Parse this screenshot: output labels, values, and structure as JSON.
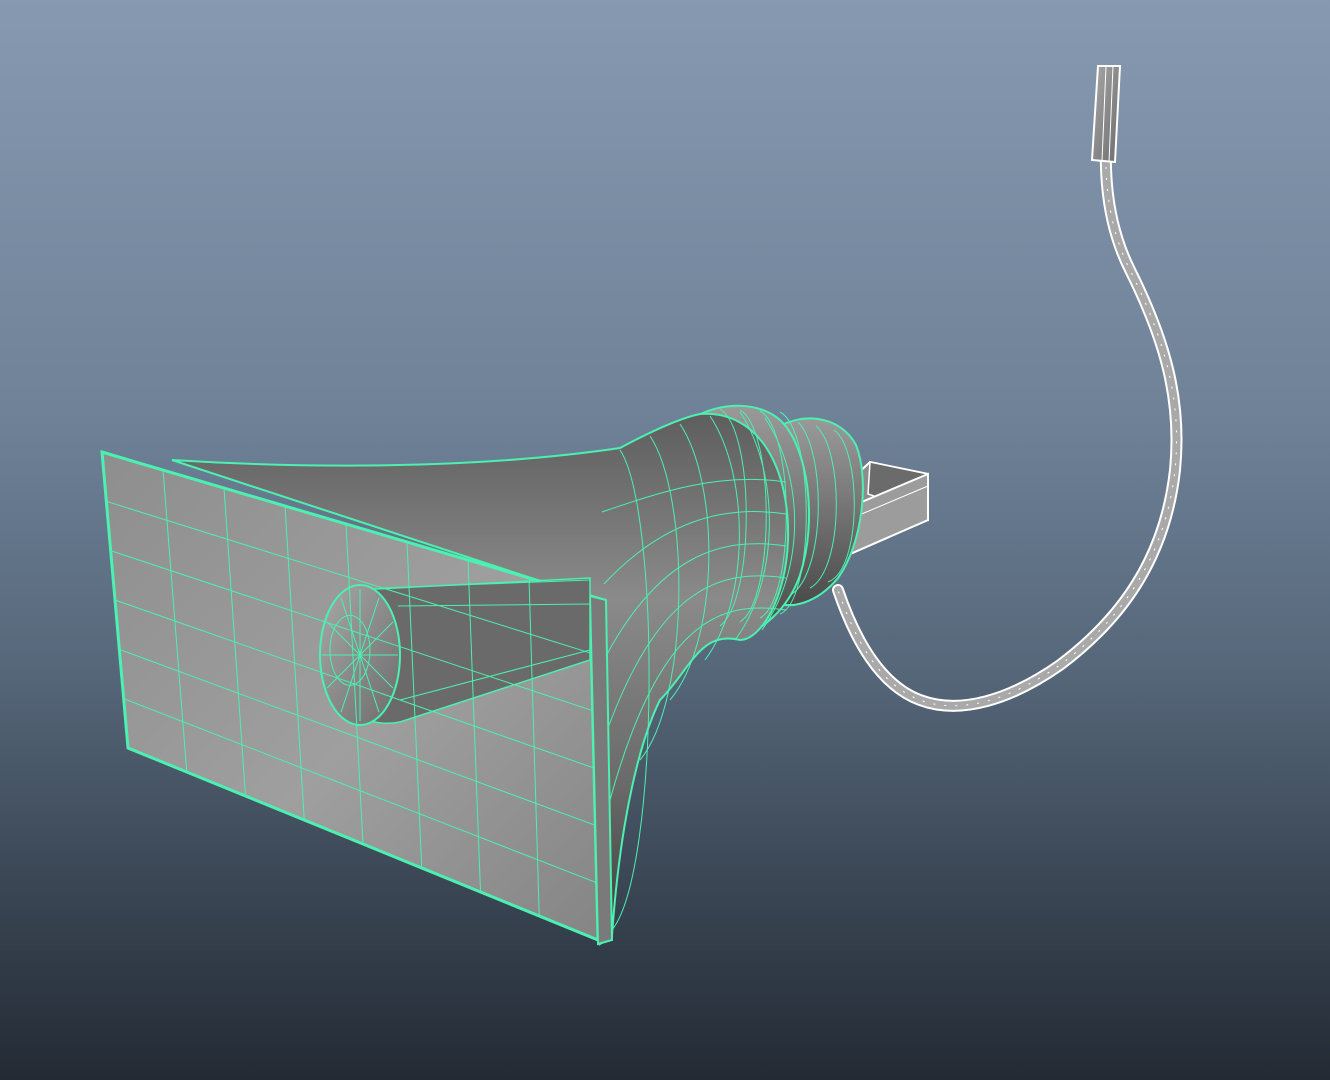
{
  "viewport": {
    "background_top": "#8799b0",
    "background_bottom": "#232a34"
  },
  "model": {
    "name": "horn-speaker",
    "selection_wire_color": "#4cf0b0",
    "surface_color": "#9a9a9a",
    "cable_wire_color": "#ffffff",
    "parts": [
      "horn-flare",
      "horn-throat",
      "driver-body",
      "driver-rear-cap",
      "phase-plug",
      "mounting-bracket",
      "bracket-bolt",
      "cable",
      "cable-plug"
    ]
  }
}
